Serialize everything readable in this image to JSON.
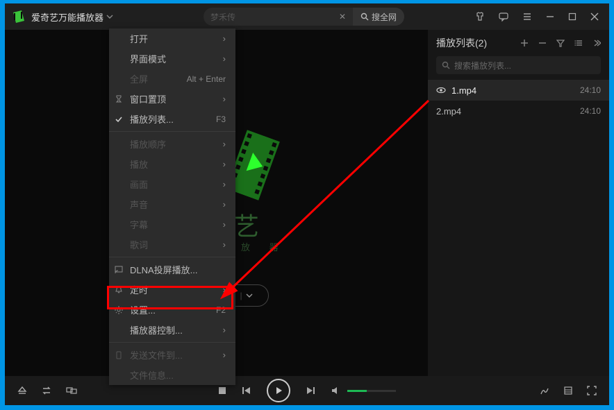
{
  "titlebar": {
    "app_name": "爱奇艺万能播放器",
    "search_placeholder": "梦禾传",
    "search_all": "搜全网"
  },
  "menu": {
    "open": "打开",
    "ui_mode": "界面模式",
    "fullscreen": "全屏",
    "fullscreen_sc": "Alt + Enter",
    "ontop": "窗口置顶",
    "playlist": "播放列表...",
    "playlist_sc": "F3",
    "order": "播放顺序",
    "playback": "播放",
    "picture": "画面",
    "audio": "声音",
    "subtitle": "字幕",
    "lyrics": "歌词",
    "dlna": "DLNA投屏播放...",
    "timer": "定时",
    "settings": "设置...",
    "settings_sc": "F2",
    "playerctl": "播放器控制...",
    "sendto": "发送文件到...",
    "fileinfo": "文件信息..."
  },
  "bg": {
    "text": "艺",
    "sub": "放  器",
    "open_drop": ""
  },
  "sidebar": {
    "title": "播放列表(2)",
    "search_placeholder": "搜索播放列表...",
    "items": [
      {
        "name": "1.mp4",
        "duration": "24:10",
        "active": true
      },
      {
        "name": "2.mp4",
        "duration": "24:10",
        "active": false
      }
    ]
  }
}
